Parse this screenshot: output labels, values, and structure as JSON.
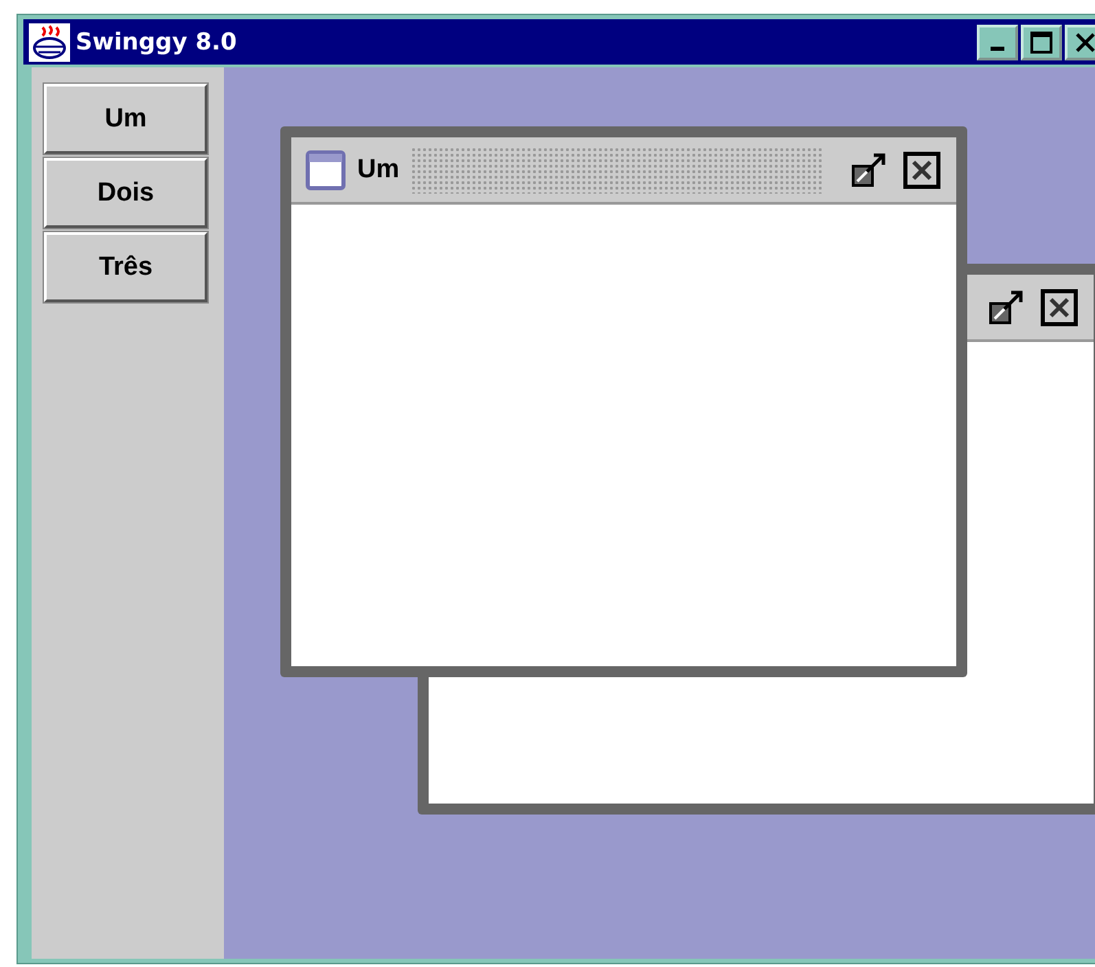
{
  "window": {
    "title": "Swinggy 8.0"
  },
  "sidebar": {
    "buttons": [
      "Um",
      "Dois",
      "Três"
    ]
  },
  "internal_frames": [
    {
      "title": "Um",
      "selected": true
    },
    {
      "selected": false
    }
  ]
}
